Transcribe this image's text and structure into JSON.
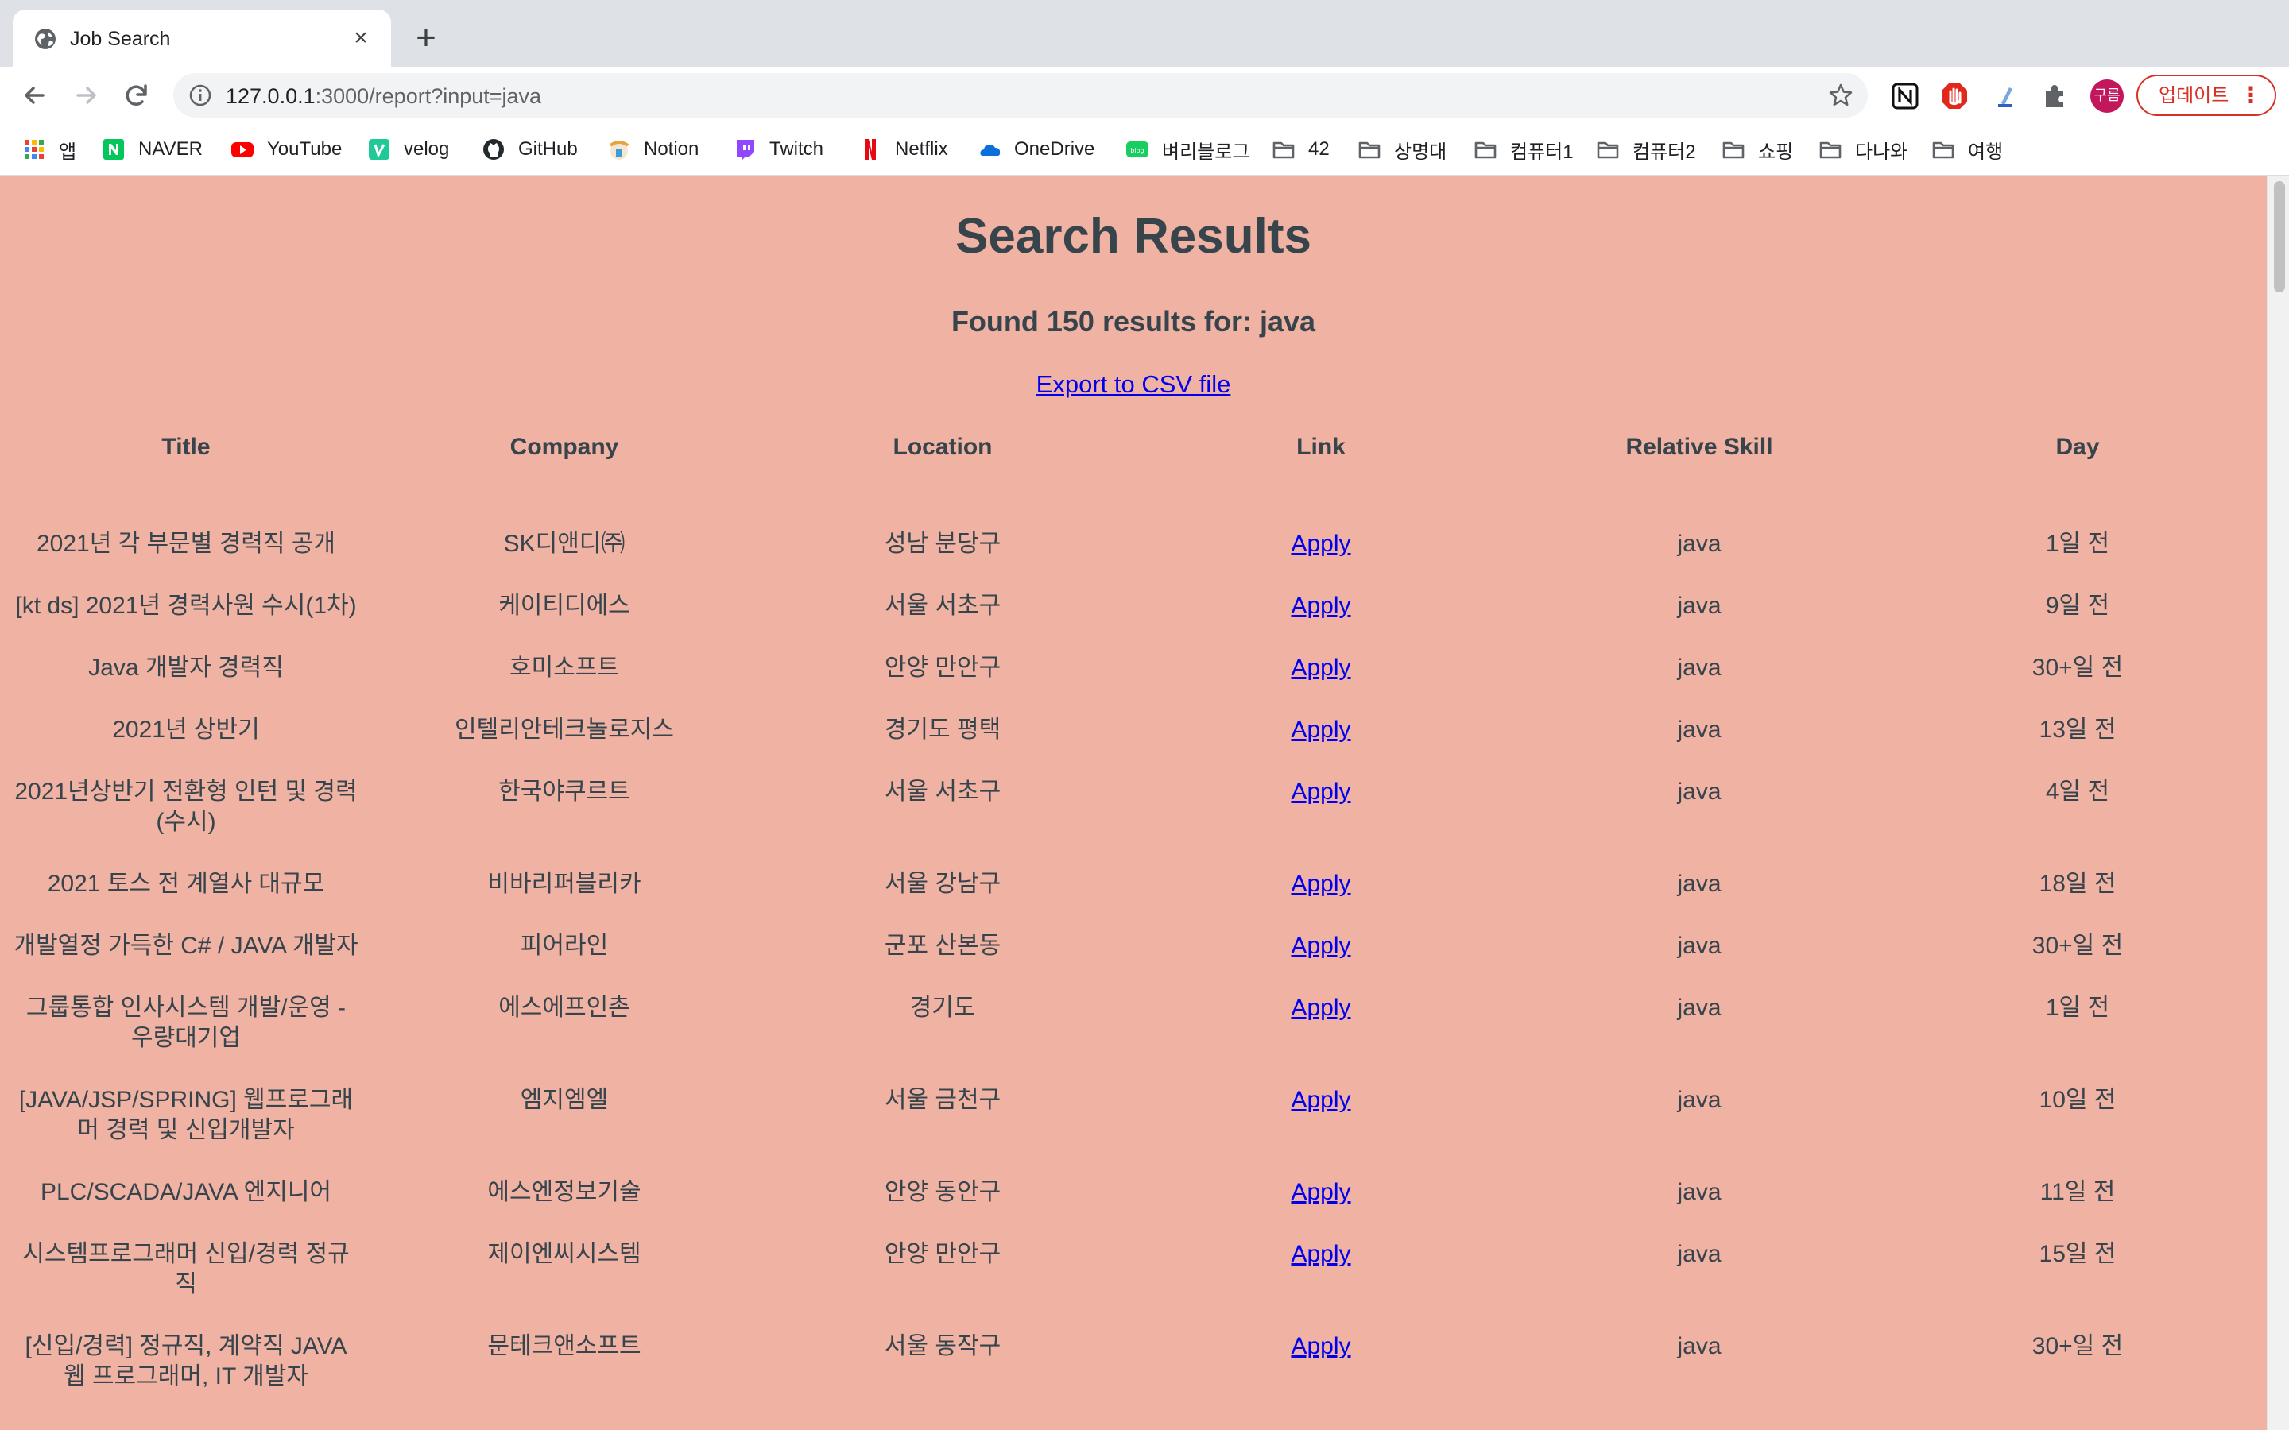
{
  "browser": {
    "tab_title": "Job Search",
    "url_host": "127.0.0.1",
    "url_rest": ":3000/report?input=java",
    "update_label": "업데이트",
    "profile_initials": "구름"
  },
  "bookmarks": [
    {
      "label": "앱",
      "icon": "apps-grid-icon",
      "color": "#ea4335"
    },
    {
      "label": "NAVER",
      "icon": "naver-icon",
      "color": "#03c75a"
    },
    {
      "label": "YouTube",
      "icon": "youtube-icon",
      "color": "#ff0000"
    },
    {
      "label": "velog",
      "icon": "velog-icon",
      "color": "#20c997"
    },
    {
      "label": "GitHub",
      "icon": "github-icon",
      "color": "#24292e"
    },
    {
      "label": "Notion",
      "icon": "notion-icon",
      "color": "#e8a33d"
    },
    {
      "label": "Twitch",
      "icon": "twitch-icon",
      "color": "#9146ff"
    },
    {
      "label": "Netflix",
      "icon": "netflix-icon",
      "color": "#e50914"
    },
    {
      "label": "OneDrive",
      "icon": "onedrive-icon",
      "color": "#0a6fd8"
    },
    {
      "label": "벼리블로그",
      "icon": "blog-icon",
      "color": "#19ce60"
    },
    {
      "label": "42",
      "icon": "folder-icon",
      "color": "#5f6368"
    },
    {
      "label": "상명대",
      "icon": "folder-icon",
      "color": "#5f6368"
    },
    {
      "label": "컴퓨터1",
      "icon": "folder-icon",
      "color": "#5f6368"
    },
    {
      "label": "컴퓨터2",
      "icon": "folder-icon",
      "color": "#5f6368"
    },
    {
      "label": "쇼핑",
      "icon": "folder-icon",
      "color": "#5f6368"
    },
    {
      "label": "다나와",
      "icon": "folder-icon",
      "color": "#5f6368"
    },
    {
      "label": "여행",
      "icon": "folder-icon",
      "color": "#5f6368"
    }
  ],
  "page": {
    "title": "Search Results",
    "summary": "Found 150 results for: java",
    "export_label": "Export to CSV file",
    "background": "#efb2a3",
    "link_color": "#0000ee"
  },
  "table": {
    "headers": [
      "Title",
      "Company",
      "Location",
      "Link",
      "Relative Skill",
      "Day"
    ],
    "rows": [
      {
        "title": "2021년 각 부문별 경력직 공개",
        "company": "SK디앤디㈜",
        "location": "성남 분당구",
        "link": "Apply",
        "skill": "java",
        "day": "1일 전"
      },
      {
        "title": "[kt ds] 2021년 경력사원 수시(1차)",
        "company": "케이티디에스",
        "location": "서울 서초구",
        "link": "Apply",
        "skill": "java",
        "day": "9일 전"
      },
      {
        "title": "Java 개발자 경력직",
        "company": "호미소프트",
        "location": "안양 만안구",
        "link": "Apply",
        "skill": "java",
        "day": "30+일 전"
      },
      {
        "title": "2021년 상반기",
        "company": "인텔리안테크놀로지스",
        "location": "경기도 평택",
        "link": "Apply",
        "skill": "java",
        "day": "13일 전"
      },
      {
        "title": "2021년상반기 전환형 인턴 및 경력 (수시)",
        "title_lines": [
          "2021년상반기 전환형 인턴 및 경력",
          "(수시)"
        ],
        "company": "한국야쿠르트",
        "location": "서울 서초구",
        "link": "Apply",
        "skill": "java",
        "day": "4일 전"
      },
      {
        "title": "2021 토스 전 계열사 대규모",
        "company": "비바리퍼블리카",
        "location": "서울 강남구",
        "link": "Apply",
        "skill": "java",
        "day": "18일 전"
      },
      {
        "title": "개발열정 가득한 C# / JAVA 개발자",
        "company": "피어라인",
        "location": "군포 산본동",
        "link": "Apply",
        "skill": "java",
        "day": "30+일 전"
      },
      {
        "title": "그룹통합 인사시스템 개발/운영 - 우량대기업",
        "title_lines": [
          "그룹통합 인사시스템 개발/운영 -",
          "우량대기업"
        ],
        "company": "에스에프인촌",
        "location": "경기도",
        "link": "Apply",
        "skill": "java",
        "day": "1일 전"
      },
      {
        "title": "[JAVA/JSP/SPRING] 웹프로그래머 경력 및 신입개발자",
        "title_lines": [
          "[JAVA/JSP/SPRING] 웹프로그래",
          "머 경력 및 신입개발자"
        ],
        "company": "엠지엠엘",
        "location": "서울 금천구",
        "link": "Apply",
        "skill": "java",
        "day": "10일 전"
      },
      {
        "title": "PLC/SCADA/JAVA 엔지니어",
        "company": "에스엔정보기술",
        "location": "안양 동안구",
        "link": "Apply",
        "skill": "java",
        "day": "11일 전"
      },
      {
        "title": "시스템프로그래머 신입/경력 정규직",
        "title_lines": [
          "시스템프로그래머 신입/경력 정규",
          "직"
        ],
        "company": "제이엔씨시스템",
        "location": "안양 만안구",
        "link": "Apply",
        "skill": "java",
        "day": "15일 전"
      },
      {
        "title": "[신입/경력] 정규직, 계약직 JAVA 웹 프로그래머, IT 개발자",
        "title_lines": [
          "[신입/경력] 정규직, 계약직 JAVA",
          "웹 프로그래머, IT 개발자"
        ],
        "company": "문테크앤소프트",
        "location": "서울 동작구",
        "link": "Apply",
        "skill": "java",
        "day": "30+일 전"
      }
    ]
  }
}
